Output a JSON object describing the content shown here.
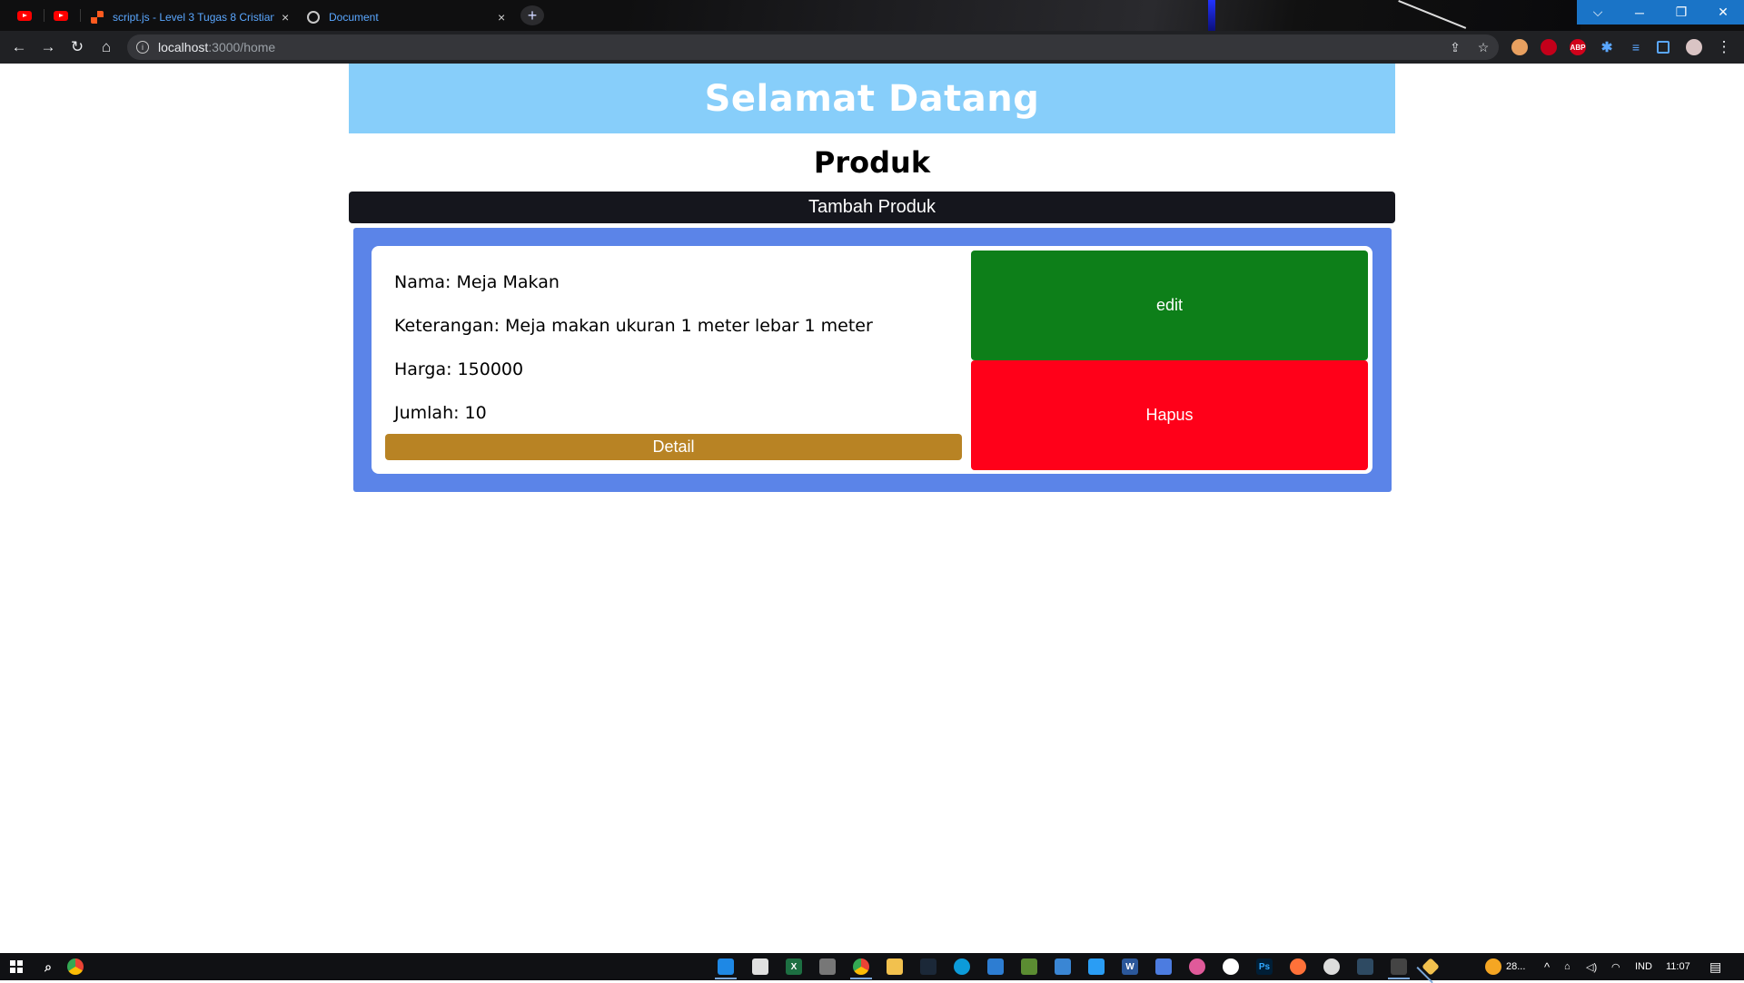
{
  "browser": {
    "tabs": [
      {
        "title": "script.js - Level 3 Tugas 8 Cristian",
        "close": "×"
      },
      {
        "title": "Document",
        "close": "×"
      }
    ],
    "new_tab": "+",
    "window_controls": {
      "tabsearch": "⌵",
      "minimize": "─",
      "restore": "❐",
      "close": "✕"
    },
    "nav": {
      "back": "←",
      "forward": "→",
      "reload": "↻",
      "home": "⌂"
    },
    "address": {
      "host": "localhost",
      "path": ":3000/home",
      "info_glyph": "i"
    },
    "omnibox_icons": {
      "share": "⇪",
      "star": "☆"
    },
    "extensions": [
      "ABP"
    ],
    "menu": "⋮"
  },
  "page": {
    "hero_title": "Selamat Datang",
    "section_title": "Produk",
    "add_button": "Tambah Produk",
    "product": {
      "nama": "Nama: Meja Makan",
      "keterangan": "Keterangan: Meja makan ukuran 1 meter lebar 1 meter",
      "harga": "Harga: 150000",
      "jumlah": "Jumlah: 10",
      "detail_button": "Detail",
      "edit_button": "edit",
      "hapus_button": "Hapus"
    }
  },
  "colors": {
    "hero_bg": "#87cefa",
    "add_button_bg": "#15161d",
    "product_wrap_bg": "#5b84e8",
    "detail_bg": "#b88324",
    "edit_bg": "#0d7f19",
    "hapus_bg": "#ff0019"
  },
  "taskbar": {
    "weather": "28...",
    "language": "IND",
    "time": "11:07"
  }
}
